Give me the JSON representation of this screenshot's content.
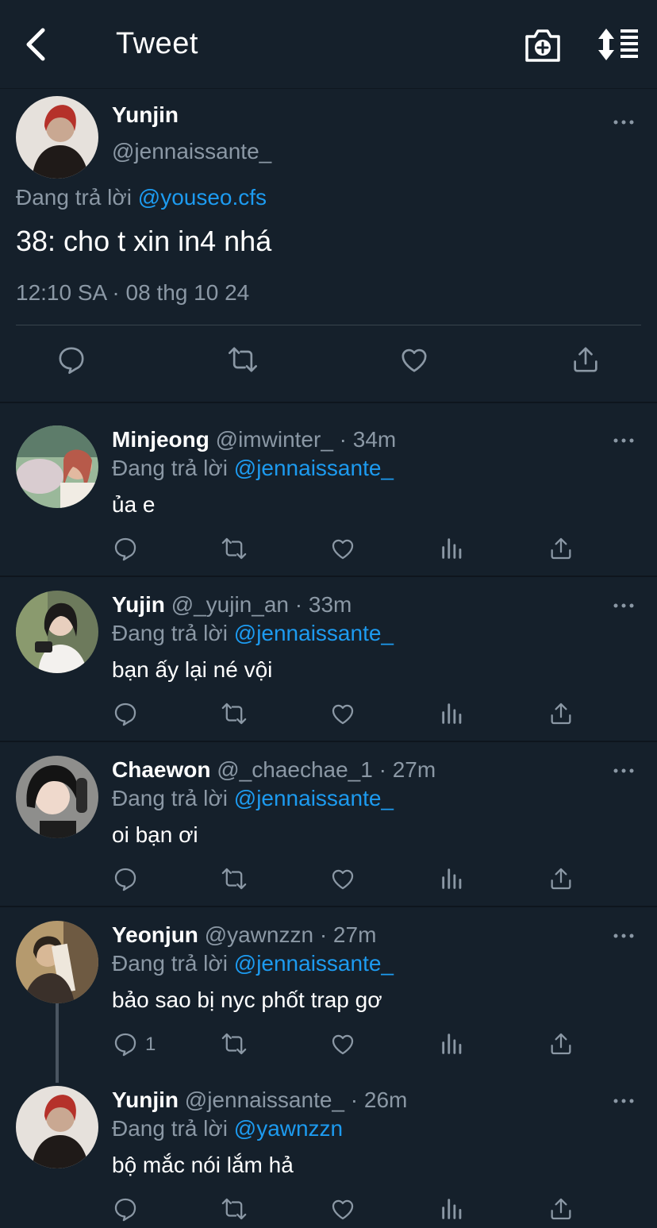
{
  "header": {
    "title": "Tweet",
    "back_icon": "chevron-left-icon",
    "camera_icon": "camera-plus-icon",
    "sort_icon": "sort-list-icon"
  },
  "main_tweet": {
    "name": "Yunjin",
    "handle": "@jennaissante_",
    "reply_prefix": "Đang trả lời",
    "reply_mention": "@youseo.cfs",
    "text": "38: cho t xin in4 nhá",
    "timestamp": "12:10 SA · 08 thg 10 24"
  },
  "replies": [
    {
      "name": "Minjeong",
      "handle": "@imwinter_ · 34m",
      "reply_prefix": "Đang trả lời",
      "mention": "@jennaissante_",
      "text": "ủa e",
      "reply_count": ""
    },
    {
      "name": "Yujin",
      "handle": "@_yujin_an · 33m",
      "reply_prefix": "Đang trả lời",
      "mention": "@jennaissante_",
      "text": "bạn ấy lại né vội",
      "reply_count": ""
    },
    {
      "name": "Chaewon",
      "handle": "@_chaechae_1 · 27m",
      "reply_prefix": "Đang trả lời",
      "mention": "@jennaissante_",
      "text": "oi bạn ơi",
      "reply_count": ""
    },
    {
      "name": "Yeonjun",
      "handle": "@yawnzzn · 27m",
      "reply_prefix": "Đang trả lời",
      "mention": "@jennaissante_",
      "text": "bảo sao bị nyc phốt trap gơ",
      "reply_count": "1"
    },
    {
      "name": "Yunjin",
      "handle": "@jennaissante_ · 26m",
      "reply_prefix": "Đang trả lời",
      "mention": "@yawnzzn",
      "text": "bộ mắc nói lắm hả",
      "reply_count": ""
    }
  ],
  "colors": {
    "background": "#15202b",
    "secondary_text": "#8b98a5",
    "mention": "#1d9bf0",
    "divider": "#38444d"
  }
}
